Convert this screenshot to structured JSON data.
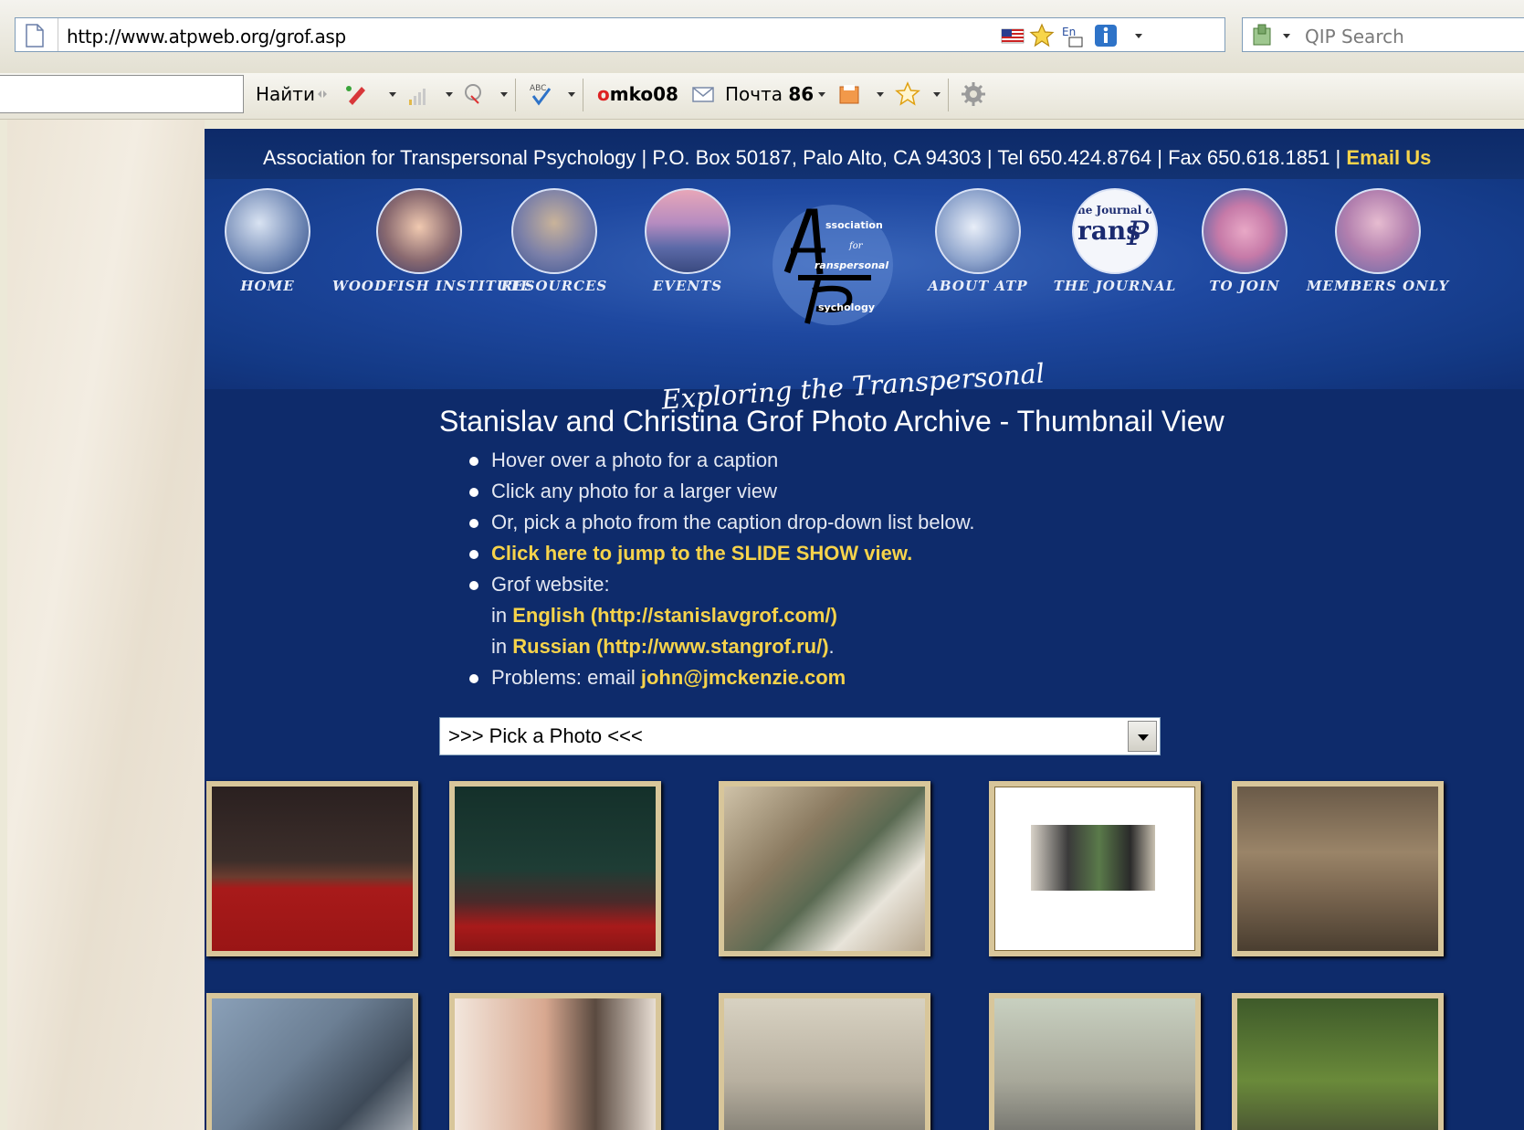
{
  "browser": {
    "url": "http://www.atpweb.org/grof.asp",
    "search_placeholder": "QIP Search"
  },
  "toolbar": {
    "find_label": "Найти",
    "username": "omko08",
    "mail_label": "Почта",
    "mail_count": "86"
  },
  "header": {
    "address_text": "Association for Transpersonal Psychology | P.O. Box 50187, Palo Alto, CA 94303 | Tel 650.424.8764 | Fax 650.618.1851 | ",
    "email_us": "Email Us",
    "tagline": "Exploring the Transpersonal"
  },
  "nav": [
    {
      "label": "HOME"
    },
    {
      "label": "WOODFISH INSTITUTE"
    },
    {
      "label": "RESOURCES"
    },
    {
      "label": "EVENTS"
    },
    {
      "label": "ABOUT ATP"
    },
    {
      "label": "THE JOURNAL"
    },
    {
      "label": "TO JOIN"
    },
    {
      "label": "MEMBERS ONLY"
    }
  ],
  "logo": {
    "line1": "ssociation",
    "line2": "for",
    "line3": "ranspersonal",
    "line4": "sychology",
    "journal_text": "he Journal o"
  },
  "main": {
    "title": "Stanislav and Christina Grof Photo Archive - Thumbnail View",
    "instructions": [
      "Hover over a photo for a caption",
      "Click any photo for a larger view",
      "Or, pick a photo from the caption drop-down list below."
    ],
    "slideshow_link": "Click here to jump to the SLIDE SHOW view.",
    "grof_website_label": "Grof website:",
    "in_label": "in ",
    "english_link": "English (http://stanislavgrof.com/)",
    "russian_link": "Russian (http://www.stangrof.ru/)",
    "russian_suffix": ".",
    "problems_label": "Problems: email ",
    "email_link": "john@jmckenzie.com",
    "select_value": ">>> Pick a Photo <<<"
  },
  "colors": {
    "page_blue": "#0e2b6b",
    "link_yellow": "#f6d34b",
    "frame_gold": "#d8c69a"
  },
  "thumbnails": [
    {
      "name": "conference-panel-red-table"
    },
    {
      "name": "dalai-lama-meeting"
    },
    {
      "name": "dinner-table"
    },
    {
      "name": "portrait-card"
    },
    {
      "name": "labyrinth-gathering"
    },
    {
      "name": "group-outdoors"
    },
    {
      "name": "two-men-talking"
    },
    {
      "name": "two-men-seated"
    },
    {
      "name": "two-men-seated-2"
    },
    {
      "name": "men-in-garden"
    }
  ]
}
